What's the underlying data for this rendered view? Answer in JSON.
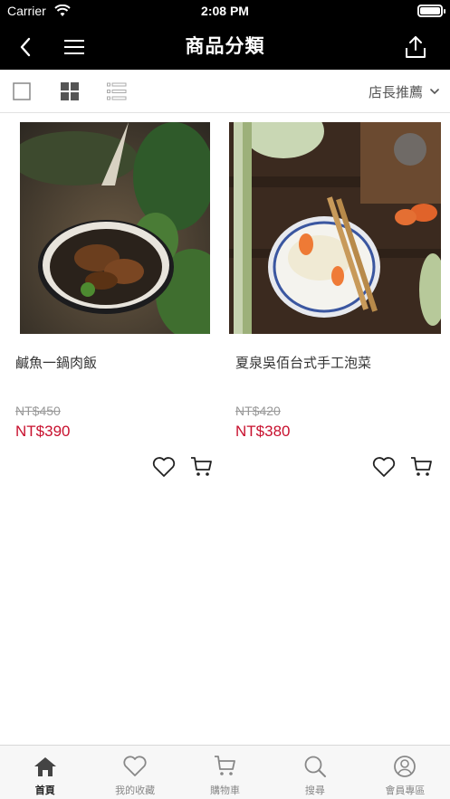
{
  "status_bar": {
    "carrier": "Carrier",
    "time": "2:08 PM"
  },
  "header": {
    "title": "商品分類"
  },
  "filter": {
    "sort_label": "店長推薦"
  },
  "products": [
    {
      "name": "鹹魚一鍋肉飯",
      "original_price": "NT$450",
      "price": "NT$390"
    },
    {
      "name": "夏泉吳佰台式手工泡菜",
      "original_price": "NT$420",
      "price": "NT$380"
    }
  ],
  "tabs": [
    {
      "label": "首頁",
      "icon": "home-icon",
      "active": true
    },
    {
      "label": "我的收藏",
      "icon": "heart-icon",
      "active": false
    },
    {
      "label": "購物車",
      "icon": "cart-icon",
      "active": false
    },
    {
      "label": "搜尋",
      "icon": "search-icon",
      "active": false
    },
    {
      "label": "會員專區",
      "icon": "user-icon",
      "active": false
    }
  ],
  "colors": {
    "header_bg": "#000000",
    "price": "#c8102e",
    "tabbar_bg": "#f7f7f7"
  }
}
